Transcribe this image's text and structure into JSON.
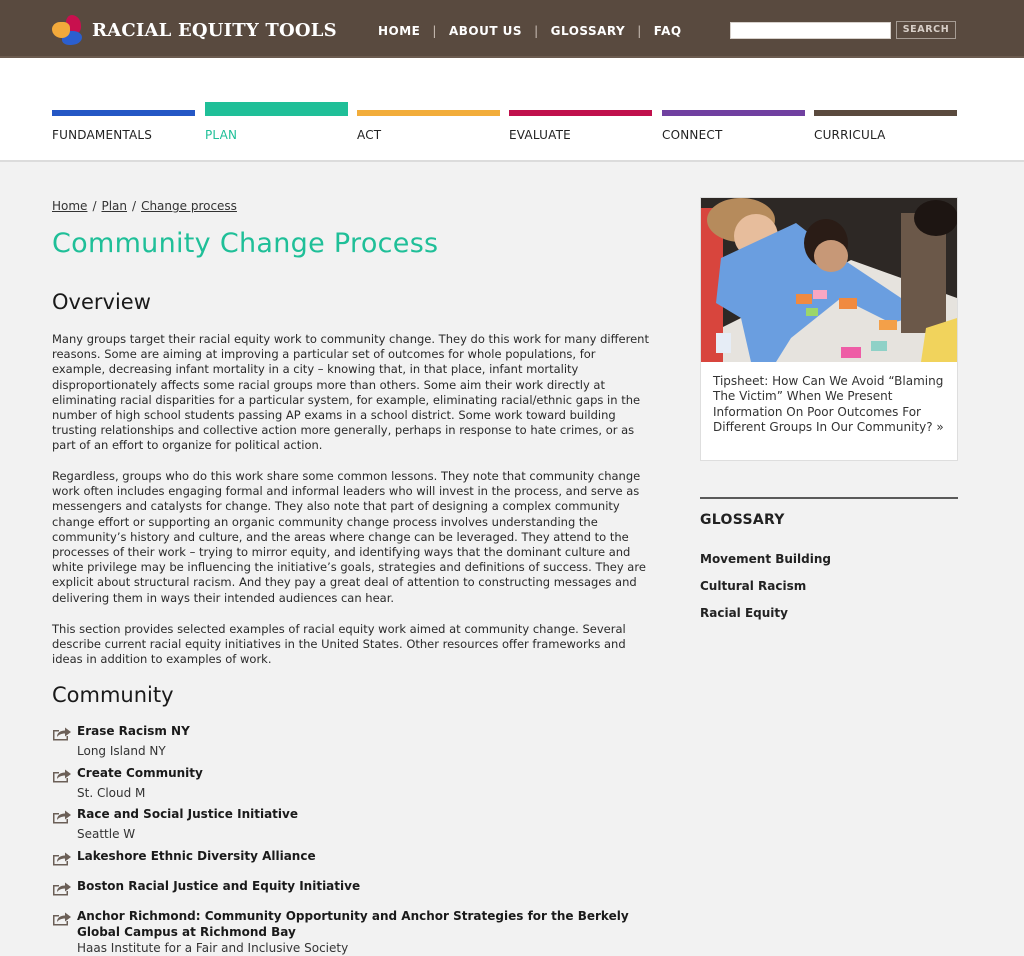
{
  "header": {
    "logo_text": "RACIAL EQUITY TOOLS",
    "nav": [
      {
        "label": "HOME"
      },
      {
        "label": "ABOUT US"
      },
      {
        "label": "GLOSSARY"
      },
      {
        "label": "FAQ"
      }
    ],
    "search": {
      "value": "",
      "placeholder": "",
      "button_label": "SEARCH"
    }
  },
  "categories": [
    {
      "label": "FUNDAMENTALS",
      "color": "#2457c5",
      "active": false
    },
    {
      "label": "PLAN",
      "color": "#1fbf98",
      "active": true
    },
    {
      "label": "ACT",
      "color": "#f2ad3b",
      "active": false
    },
    {
      "label": "EVALUATE",
      "color": "#c0104c",
      "active": false
    },
    {
      "label": "CONNECT",
      "color": "#7040a0",
      "active": false
    },
    {
      "label": "CURRICULA",
      "color": "#5a4a3d",
      "active": false
    }
  ],
  "breadcrumb": [
    {
      "label": "Home"
    },
    {
      "label": "Plan"
    },
    {
      "label": "Change process"
    }
  ],
  "main": {
    "title": "Community Change Process",
    "overview_heading": "Overview",
    "paragraphs": [
      "Many groups target their racial equity work to community change. They do this work for many different reasons. Some are aiming at improving a particular set of outcomes for whole populations, for example, decreasing infant mortality in a city – knowing that, in that place, infant mortality disproportionately affects some racial groups more than others. Some aim their work directly at eliminating racial disparities for a particular system, for example, eliminating racial/ethnic gaps in the number of high school students passing AP exams in a school district. Some work toward building trusting relationships and collective action more generally, perhaps in response to hate crimes, or as part of an effort to organize for political action.",
      "Regardless, groups who do this work share some common lessons. They note that community change work often includes engaging formal and informal leaders who will invest in the process, and serve as messengers and catalysts for change. They also note that part of designing a complex community change effort or supporting an organic community change process involves understanding the community’s history and culture, and the areas where change can be leveraged. They attend to the processes of their work – trying to mirror equity, and identifying ways that the dominant culture and white privilege may be influencing the initiative’s goals, strategies and definitions of success. They are explicit about structural racism. And they pay a great deal of attention to constructing messages and delivering them in ways their intended audiences can hear.",
      "This section provides selected examples of racial equity work aimed at community change. Several describe current racial equity initiatives in the United States. Other resources offer frameworks and ideas in addition to examples of work."
    ],
    "community_heading": "Community",
    "resources": [
      {
        "title": "Erase Racism NY",
        "sub": "Long Island NY"
      },
      {
        "title": "Create Community",
        "sub": "St. Cloud M"
      },
      {
        "title": "Race and Social Justice Initiative",
        "sub": "Seattle W"
      },
      {
        "title": "Lakeshore Ethnic Diversity Alliance",
        "sub": ""
      },
      {
        "title": "Boston Racial Justice and Equity Initiative",
        "sub": ""
      },
      {
        "title": "Anchor Richmond: Community Opportunity and Anchor Strategies for the Berkely Global Campus at Richmond Bay",
        "sub": "Haas Institute for a Fair and Inclusive Society"
      }
    ]
  },
  "sidebar": {
    "card": {
      "image_alt": "People working around a table with colorful sticky notes",
      "text": "Tipsheet: How Can We Avoid “Blaming The Victim” When We Present Information On Poor Outcomes For Different Groups In Our Community? »"
    },
    "glossary_heading": "GLOSSARY",
    "glossary_items": [
      {
        "label": "Movement Building"
      },
      {
        "label": "Cultural Racism"
      },
      {
        "label": "Racial Equity"
      }
    ]
  }
}
